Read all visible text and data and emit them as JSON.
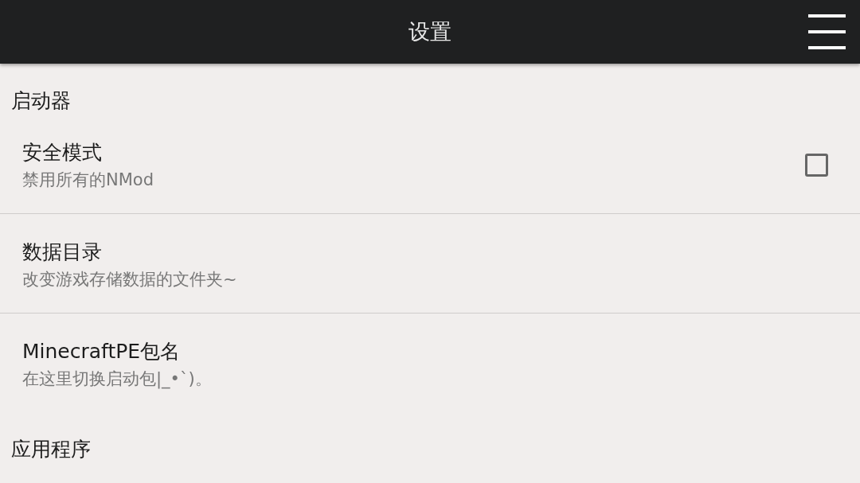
{
  "app_bar": {
    "title": "设置"
  },
  "sections": [
    {
      "title": "启动器",
      "items": [
        {
          "kind": "checkbox",
          "title": "安全模式",
          "subtitle": "禁用所有的NMod",
          "checked": false
        },
        {
          "kind": "plain",
          "title": "数据目录",
          "subtitle": "改变游戏存储数据的文件夹~"
        },
        {
          "kind": "plain",
          "title": "MinecraftPE包名",
          "subtitle": "在这里切换启动包|_•`)。"
        }
      ]
    },
    {
      "title": "应用程序"
    }
  ]
}
